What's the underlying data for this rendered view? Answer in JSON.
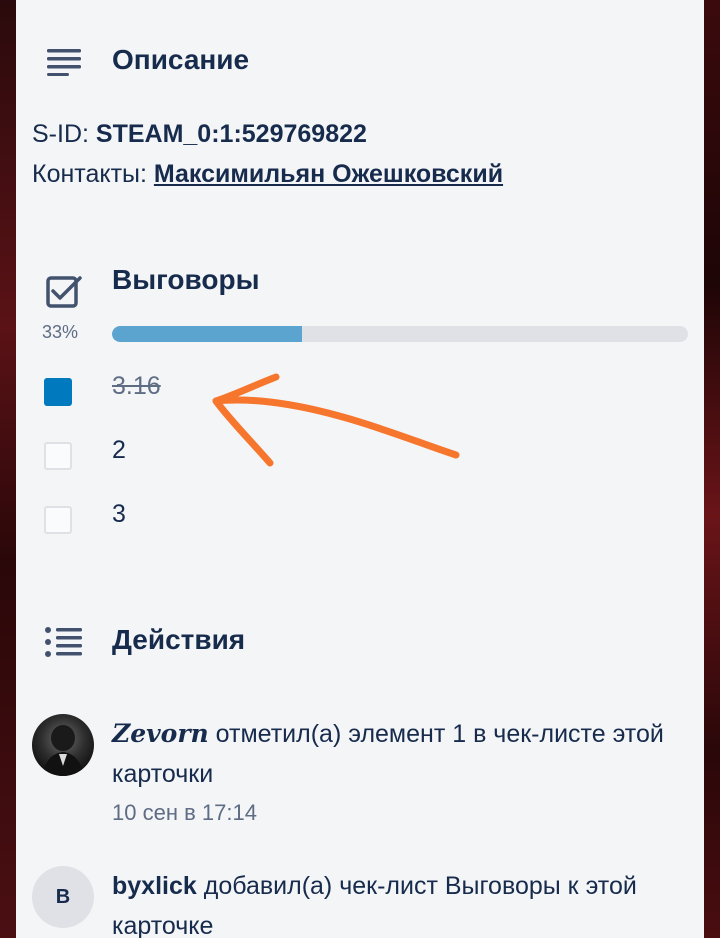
{
  "description": {
    "title": "Описание",
    "sid_label": "S-ID:",
    "sid_value": "STEAM_0:1:529769822",
    "contacts_label": "Контакты:",
    "contacts_link": "Максимильян Ожешковский"
  },
  "checklist": {
    "title": "Выговоры",
    "progress_text": "33%",
    "progress_value": 0.33,
    "items": [
      {
        "label": "3.16",
        "checked": true
      },
      {
        "label": "2",
        "checked": false
      },
      {
        "label": "3",
        "checked": false
      }
    ]
  },
  "activity": {
    "title": "Действия",
    "entries": [
      {
        "user": "Zevorn",
        "text": " отметил(а) элемент 1 в чек-листе этой карточки",
        "time": "10 сен в 17:14"
      },
      {
        "avatar_letter": "B",
        "user": "byxlick",
        "text": " добавил(а) чек-лист Выговоры к этой карточке"
      }
    ]
  },
  "colors": {
    "accent": "#0079bf",
    "progress_fill": "#5ba4cf",
    "annotation_arrow": "#f7762d",
    "text": "#172b4d"
  }
}
